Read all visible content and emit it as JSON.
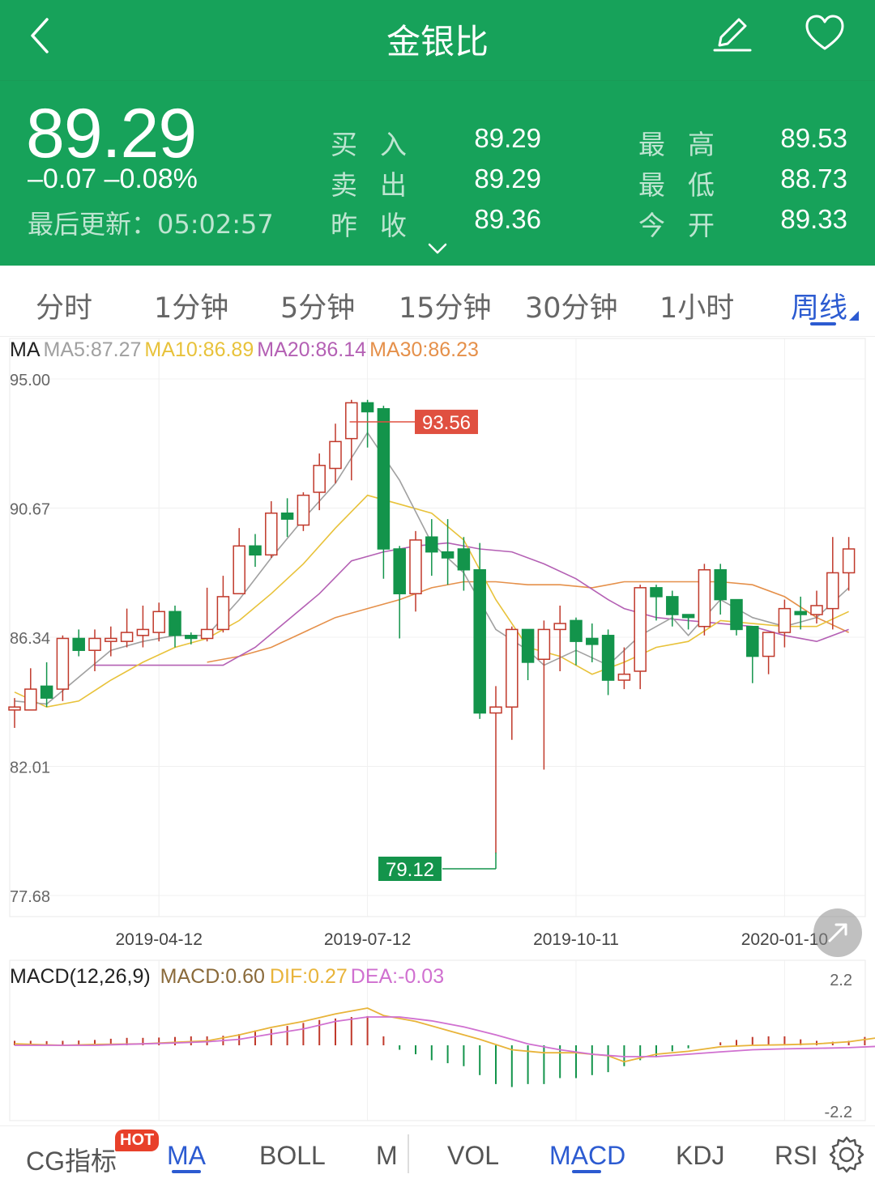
{
  "header": {
    "title": "金银比",
    "price": "89.29",
    "change": "–0.07  –0.08%",
    "update_label": "最后更新：",
    "update_time": "05:02:57",
    "quotes": [
      {
        "label": "买入",
        "value": "89.29"
      },
      {
        "label": "卖出",
        "value": "89.29"
      },
      {
        "label": "昨收",
        "value": "89.36"
      },
      {
        "label": "最高",
        "value": "89.53"
      },
      {
        "label": "最低",
        "value": "88.73"
      },
      {
        "label": "今开",
        "value": "89.33"
      }
    ],
    "colors": {
      "bg": "#17a25a"
    }
  },
  "period_tabs": [
    "分时",
    "1分钟",
    "5分钟",
    "15分钟",
    "30分钟",
    "1小时",
    "周线"
  ],
  "active_period": "周线",
  "ma_legend": {
    "name": "MA",
    "ma5": "MA5:87.27",
    "ma10": "MA10:86.89",
    "ma20": "MA20:86.14",
    "ma30": "MA30:86.23",
    "colors": {
      "ma5": "#a0a0a0",
      "ma10": "#e8c23a",
      "ma20": "#b460b4",
      "ma30": "#e5904a"
    }
  },
  "macd_legend": {
    "name": "MACD(12,26,9)",
    "macd": "MACD:0.60",
    "dif": "DIF:0.27",
    "dea": "DEA:-0.03",
    "colors": {
      "macd": "#8a6a3a",
      "dif": "#e8b43a",
      "dea": "#d070d0"
    }
  },
  "bottom_tabs": {
    "items": [
      "CG指标",
      "MA",
      "BOLL",
      "M",
      "VOL",
      "MACD",
      "KDJ",
      "RSI"
    ],
    "hot_badge": "HOT",
    "active": [
      "MA",
      "MACD"
    ]
  },
  "chart_data": [
    {
      "type": "candlestick",
      "y_ticks": [
        "95.00",
        "90.67",
        "86.34",
        "82.01",
        "77.68"
      ],
      "ylim": [
        77.68,
        95.0
      ],
      "x_ticks": [
        {
          "index": 9,
          "label": "2019-04-12"
        },
        {
          "index": 22,
          "label": "2019-07-12"
        },
        {
          "index": 35,
          "label": "2019-10-11"
        },
        {
          "index": 48,
          "label": "2020-01-10"
        }
      ],
      "max_label": "93.56",
      "min_label": "79.12",
      "max_index": 22,
      "min_index": 30,
      "colors": {
        "up": "#c0392b",
        "down": "#13944b",
        "max_tag": "#e05040",
        "min_tag": "#13944b"
      },
      "candles": [
        [
          83.9,
          84.0,
          83.3,
          84.3
        ],
        [
          83.9,
          84.6,
          84.3,
          85.3
        ],
        [
          84.7,
          84.3,
          84.0,
          85.5
        ],
        [
          84.6,
          86.3,
          84.2,
          86.4
        ],
        [
          86.3,
          85.9,
          85.7,
          86.6
        ],
        [
          85.9,
          86.3,
          85.2,
          86.6
        ],
        [
          86.2,
          86.3,
          85.7,
          86.7
        ],
        [
          86.2,
          86.5,
          86.0,
          87.3
        ],
        [
          86.4,
          86.6,
          86.0,
          87.4
        ],
        [
          86.5,
          87.2,
          86.2,
          87.5
        ],
        [
          87.2,
          86.4,
          86.0,
          87.4
        ],
        [
          86.4,
          86.3,
          86.1,
          86.5
        ],
        [
          86.3,
          86.6,
          86.2,
          88.0
        ],
        [
          86.6,
          87.7,
          86.5,
          88.4
        ],
        [
          87.8,
          89.4,
          87.8,
          90.0
        ],
        [
          89.4,
          89.1,
          88.7,
          89.8
        ],
        [
          89.1,
          90.5,
          89.0,
          90.9
        ],
        [
          90.5,
          90.3,
          89.7,
          91.0
        ],
        [
          90.1,
          91.1,
          89.9,
          91.2
        ],
        [
          91.2,
          92.1,
          90.6,
          92.5
        ],
        [
          92.0,
          92.9,
          91.5,
          93.5
        ],
        [
          93.0,
          94.2,
          91.6,
          94.3
        ],
        [
          94.2,
          93.9,
          92.7,
          94.3
        ],
        [
          94.0,
          89.3,
          88.3,
          94.1
        ],
        [
          89.3,
          87.8,
          86.3,
          89.4
        ],
        [
          87.8,
          89.6,
          87.2,
          89.9
        ],
        [
          89.7,
          89.2,
          88.4,
          90.3
        ],
        [
          89.2,
          89.0,
          88.1,
          90.3
        ],
        [
          89.3,
          88.6,
          87.9,
          89.7
        ],
        [
          88.6,
          83.8,
          83.6,
          89.5
        ],
        [
          83.8,
          84.0,
          79.1,
          84.7
        ],
        [
          84.0,
          86.6,
          82.9,
          86.7
        ],
        [
          86.6,
          85.5,
          84.9,
          86.6
        ],
        [
          85.6,
          86.6,
          81.9,
          86.9
        ],
        [
          86.6,
          86.8,
          85.2,
          87.4
        ],
        [
          86.9,
          86.2,
          85.4,
          87.0
        ],
        [
          86.3,
          86.1,
          85.5,
          86.8
        ],
        [
          86.4,
          84.9,
          84.4,
          86.6
        ],
        [
          84.9,
          85.1,
          84.6,
          86.0
        ],
        [
          85.2,
          88.0,
          84.6,
          88.1
        ],
        [
          88.0,
          87.7,
          86.9,
          88.1
        ],
        [
          87.7,
          87.1,
          86.7,
          87.9
        ],
        [
          87.1,
          87.0,
          86.6,
          87.1
        ],
        [
          86.7,
          88.6,
          86.4,
          88.8
        ],
        [
          88.6,
          87.6,
          87.1,
          88.8
        ],
        [
          87.6,
          86.6,
          86.4,
          87.6
        ],
        [
          86.7,
          85.7,
          84.8,
          86.7
        ],
        [
          85.7,
          86.5,
          85.1,
          86.5
        ],
        [
          86.5,
          87.3,
          86.0,
          87.6
        ],
        [
          87.2,
          87.1,
          86.6,
          87.7
        ],
        [
          87.1,
          87.4,
          86.8,
          87.9
        ],
        [
          87.3,
          88.5,
          86.6,
          89.7
        ],
        [
          88.5,
          89.3,
          87.9,
          89.7
        ]
      ],
      "ma5": [
        [
          0,
          84.2
        ],
        [
          2,
          84.1
        ],
        [
          4,
          85.0
        ],
        [
          6,
          85.9
        ],
        [
          8,
          86.2
        ],
        [
          10,
          86.4
        ],
        [
          12,
          86.4
        ],
        [
          14,
          87.6
        ],
        [
          16,
          89.0
        ],
        [
          18,
          90.3
        ],
        [
          20,
          91.5
        ],
        [
          22,
          93.2
        ],
        [
          24,
          91.6
        ],
        [
          26,
          89.5
        ],
        [
          28,
          88.5
        ],
        [
          30,
          86.6
        ],
        [
          32,
          85.9
        ],
        [
          33,
          85.4
        ],
        [
          35,
          85.9
        ],
        [
          37,
          85.4
        ],
        [
          39,
          86.4
        ],
        [
          41,
          87.0
        ],
        [
          42,
          86.4
        ],
        [
          44,
          87.6
        ],
        [
          46,
          87.0
        ],
        [
          48,
          86.7
        ],
        [
          50,
          87.0
        ],
        [
          52,
          88.0
        ]
      ],
      "ma10": [
        [
          0,
          84.5
        ],
        [
          2,
          84.0
        ],
        [
          4,
          84.2
        ],
        [
          6,
          84.9
        ],
        [
          8,
          85.5
        ],
        [
          10,
          86.0
        ],
        [
          12,
          86.3
        ],
        [
          14,
          86.9
        ],
        [
          16,
          87.8
        ],
        [
          18,
          88.8
        ],
        [
          20,
          90.0
        ],
        [
          22,
          91.1
        ],
        [
          24,
          90.8
        ],
        [
          26,
          90.5
        ],
        [
          28,
          89.6
        ],
        [
          30,
          87.6
        ],
        [
          32,
          86.0
        ],
        [
          34,
          85.7
        ],
        [
          36,
          85.1
        ],
        [
          38,
          85.5
        ],
        [
          40,
          86.0
        ],
        [
          42,
          86.2
        ],
        [
          44,
          86.9
        ],
        [
          46,
          86.8
        ],
        [
          48,
          86.7
        ],
        [
          50,
          86.7
        ],
        [
          52,
          87.2
        ]
      ],
      "ma20": [
        [
          5,
          85.4
        ],
        [
          8,
          85.4
        ],
        [
          11,
          85.4
        ],
        [
          13,
          85.4
        ],
        [
          15,
          86.0
        ],
        [
          17,
          86.9
        ],
        [
          19,
          87.8
        ],
        [
          21,
          88.9
        ],
        [
          23,
          89.2
        ],
        [
          25,
          89.4
        ],
        [
          27,
          89.5
        ],
        [
          29,
          89.3
        ],
        [
          31,
          89.2
        ],
        [
          33,
          88.8
        ],
        [
          35,
          88.3
        ],
        [
          37,
          87.6
        ],
        [
          38,
          87.3
        ],
        [
          40,
          87.0
        ],
        [
          42,
          86.9
        ],
        [
          44,
          86.8
        ],
        [
          46,
          86.7
        ],
        [
          48,
          86.4
        ],
        [
          50,
          86.2
        ],
        [
          52,
          86.6
        ]
      ],
      "ma30": [
        [
          12,
          85.5
        ],
        [
          14,
          85.7
        ],
        [
          16,
          86.0
        ],
        [
          18,
          86.5
        ],
        [
          20,
          87.0
        ],
        [
          22,
          87.3
        ],
        [
          24,
          87.6
        ],
        [
          26,
          88.0
        ],
        [
          28,
          88.2
        ],
        [
          30,
          88.2
        ],
        [
          32,
          88.1
        ],
        [
          34,
          88.1
        ],
        [
          36,
          88.0
        ],
        [
          38,
          88.2
        ],
        [
          40,
          88.2
        ],
        [
          42,
          88.2
        ],
        [
          44,
          88.2
        ],
        [
          46,
          88.1
        ],
        [
          48,
          87.7
        ],
        [
          50,
          87.0
        ],
        [
          52,
          86.5
        ]
      ]
    },
    {
      "type": "macd",
      "y_ticks": [
        "2.2",
        "-2.2"
      ],
      "ylim": [
        -2.2,
        2.2
      ],
      "hist": [
        0.15,
        0.15,
        0.14,
        0.15,
        0.16,
        0.18,
        0.22,
        0.25,
        0.25,
        0.26,
        0.28,
        0.3,
        0.3,
        0.32,
        0.38,
        0.5,
        0.55,
        0.65,
        0.75,
        0.85,
        0.9,
        0.95,
        0.98,
        0.3,
        -0.15,
        -0.3,
        -0.5,
        -0.6,
        -0.7,
        -1.0,
        -1.3,
        -1.4,
        -1.3,
        -1.3,
        -1.1,
        -1.1,
        -1.0,
        -0.9,
        -0.7,
        -0.5,
        -0.4,
        -0.2,
        -0.1,
        0.0,
        0.1,
        0.18,
        0.28,
        0.3,
        0.3,
        0.2,
        0.15,
        0.12,
        0.15,
        0.28,
        0.4
      ],
      "dif": [
        [
          0,
          0.05
        ],
        [
          3,
          0.0
        ],
        [
          5,
          0.03
        ],
        [
          8,
          0.05
        ],
        [
          10,
          0.1
        ],
        [
          12,
          0.15
        ],
        [
          14,
          0.35
        ],
        [
          16,
          0.6
        ],
        [
          18,
          0.8
        ],
        [
          20,
          1.05
        ],
        [
          22,
          1.25
        ],
        [
          23,
          1.0
        ],
        [
          25,
          0.8
        ],
        [
          27,
          0.5
        ],
        [
          29,
          0.2
        ],
        [
          31,
          -0.15
        ],
        [
          33,
          -0.25
        ],
        [
          35,
          -0.25
        ],
        [
          37,
          -0.35
        ],
        [
          38,
          -0.55
        ],
        [
          40,
          -0.3
        ],
        [
          42,
          -0.2
        ],
        [
          44,
          -0.05
        ],
        [
          46,
          0.0
        ],
        [
          48,
          0.02
        ],
        [
          50,
          0.05
        ],
        [
          52,
          0.12
        ],
        [
          54,
          0.27
        ]
      ],
      "dea": [
        [
          0,
          0.0
        ],
        [
          3,
          0.0
        ],
        [
          5,
          0.0
        ],
        [
          8,
          0.05
        ],
        [
          10,
          0.08
        ],
        [
          12,
          0.12
        ],
        [
          14,
          0.2
        ],
        [
          16,
          0.38
        ],
        [
          18,
          0.55
        ],
        [
          20,
          0.8
        ],
        [
          22,
          0.95
        ],
        [
          24,
          0.95
        ],
        [
          26,
          0.82
        ],
        [
          28,
          0.62
        ],
        [
          30,
          0.35
        ],
        [
          32,
          0.05
        ],
        [
          34,
          -0.15
        ],
        [
          36,
          -0.3
        ],
        [
          38,
          -0.38
        ],
        [
          40,
          -0.38
        ],
        [
          42,
          -0.3
        ],
        [
          44,
          -0.22
        ],
        [
          46,
          -0.15
        ],
        [
          48,
          -0.12
        ],
        [
          50,
          -0.1
        ],
        [
          52,
          -0.08
        ],
        [
          54,
          -0.03
        ]
      ]
    }
  ]
}
